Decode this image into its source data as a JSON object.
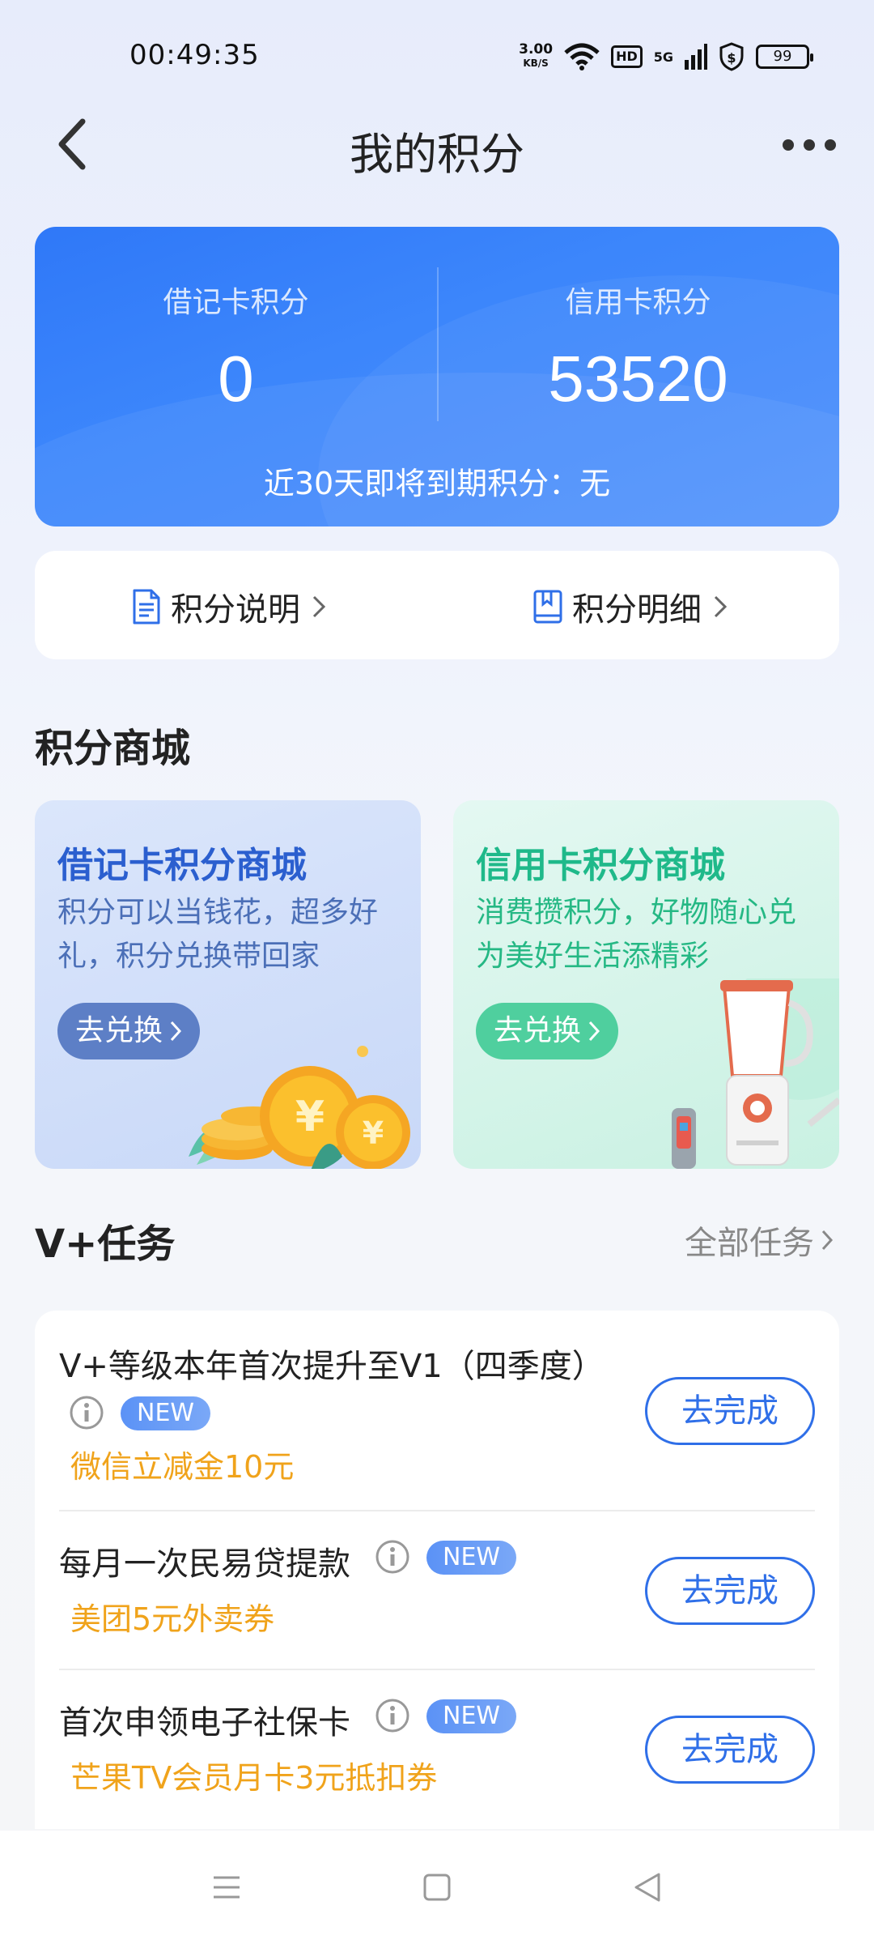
{
  "status_bar": {
    "time": "00:49:35",
    "speed_value": "3.00",
    "speed_unit": "KB/S",
    "hd_label": "HD",
    "network_label": "5G",
    "battery": "99"
  },
  "header": {
    "title": "我的积分"
  },
  "points": {
    "debit_label": "借记卡积分",
    "debit_value": "0",
    "credit_label": "信用卡积分",
    "credit_value": "53520",
    "expiring_text": "近30天即将到期积分：无"
  },
  "links": {
    "explain_label": "积分说明",
    "detail_label": "积分明细"
  },
  "mall": {
    "section_title": "积分商城",
    "debit": {
      "title": "借记卡积分商城",
      "desc": "积分可以当钱花，超多好礼，积分兑换带回家",
      "button": "去兑换"
    },
    "credit": {
      "title": "信用卡积分商城",
      "desc": "消费攒积分，好物随心兑为美好生活添精彩",
      "button": "去兑换"
    }
  },
  "tasks": {
    "section_title": "V+任务",
    "all_label": "全部任务",
    "items": [
      {
        "title": "V+等级本年首次提升至V1（四季度）",
        "badge": "NEW",
        "reward": "微信立减金10元",
        "button": "去完成"
      },
      {
        "title": "每月一次民易贷提款",
        "badge": "NEW",
        "reward": "美团5元外卖券",
        "button": "去完成"
      },
      {
        "title": "首次申领电子社保卡",
        "badge": "NEW",
        "reward": "芒果TV会员月卡3元抵扣券",
        "button": "去完成"
      }
    ]
  },
  "colors": {
    "primary_blue": "#2f6fe8",
    "reward_orange": "#f0a31b",
    "credit_green": "#1fb98a"
  },
  "icons": [
    "back-arrow-icon",
    "more-dots-icon",
    "document-icon",
    "book-icon",
    "chevron-right-icon",
    "info-icon",
    "menu-icon",
    "home-square-icon",
    "back-triangle-icon",
    "wifi-icon",
    "signal-icon",
    "shield-icon"
  ]
}
